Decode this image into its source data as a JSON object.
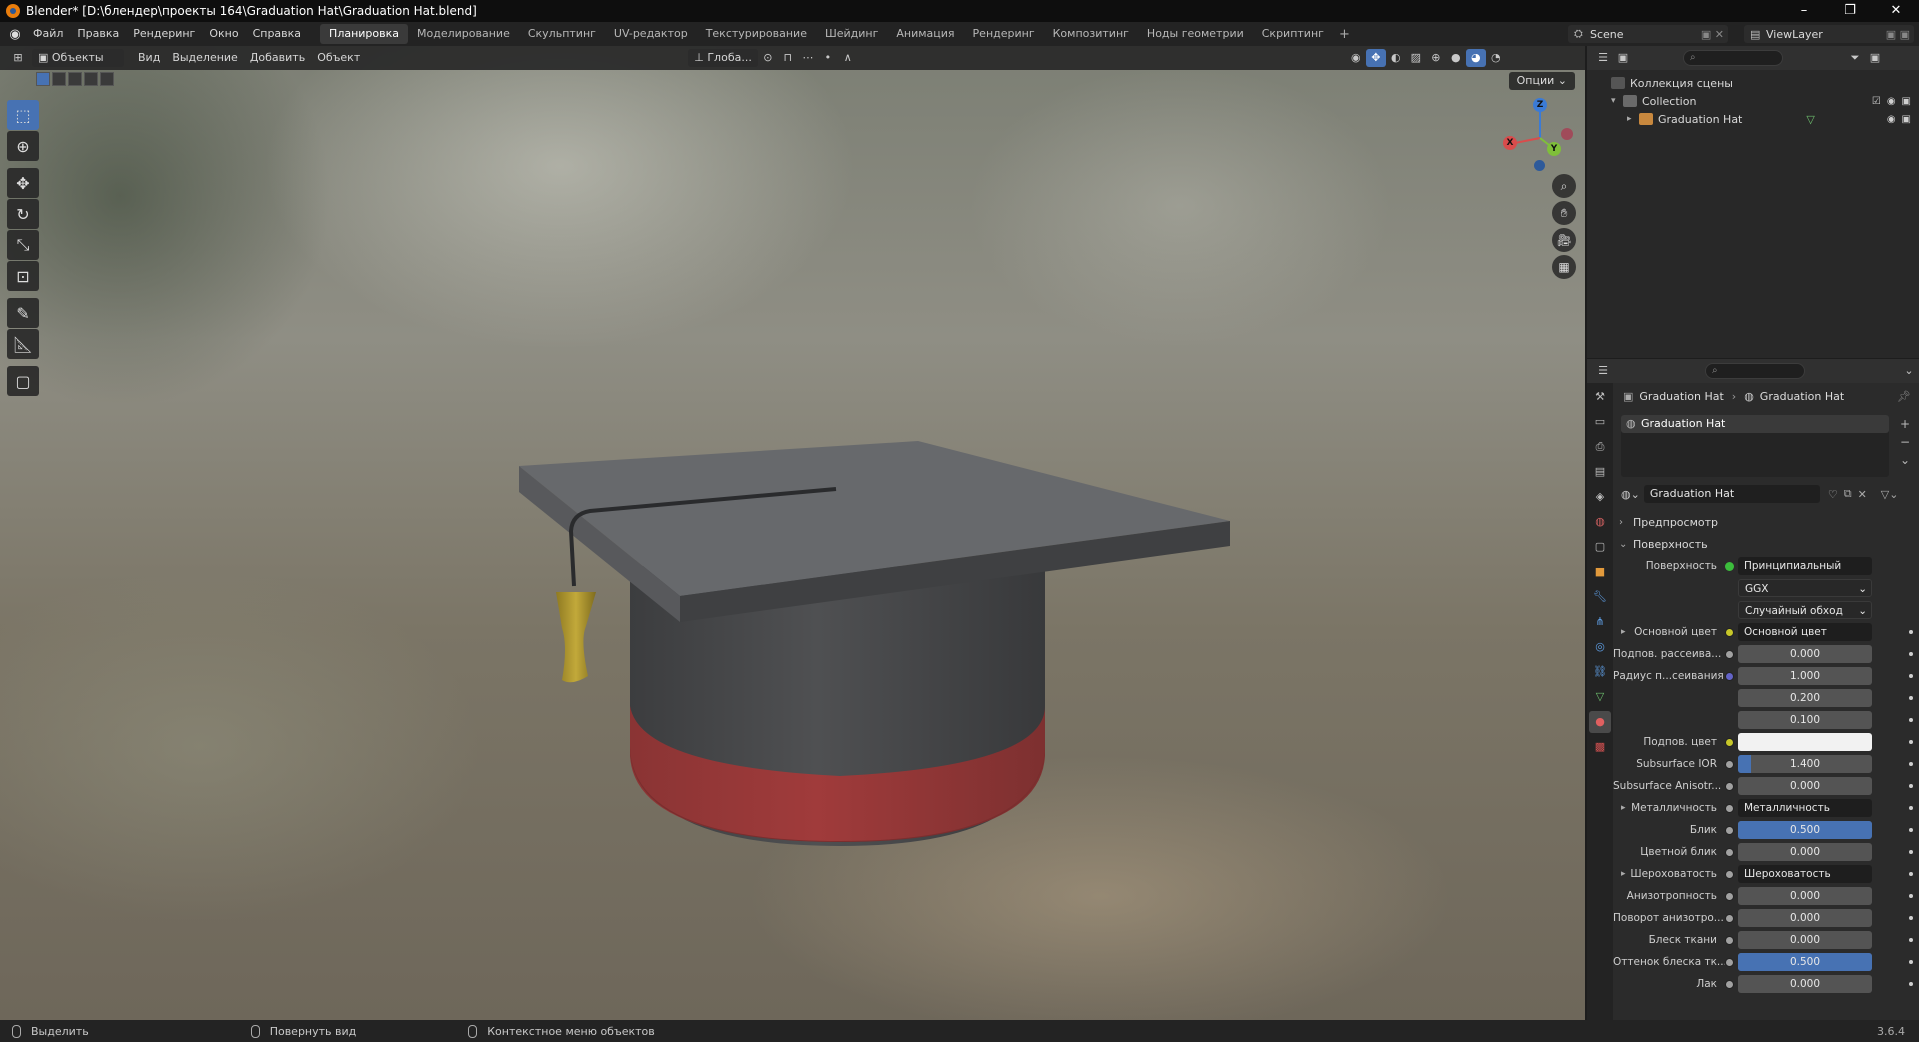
{
  "window": {
    "title": "Blender* [D:\\блендер\\проекты 164\\Graduation Hat\\Graduation Hat.blend]",
    "minimize": "–",
    "maximize": "❐",
    "close": "✕"
  },
  "menubar": {
    "items": [
      "Файл",
      "Правка",
      "Рендеринг",
      "Окно",
      "Справка"
    ],
    "workspaces": [
      "Планировка",
      "Моделирование",
      "Скульптинг",
      "UV-редактор",
      "Текстурирование",
      "Шейдинг",
      "Анимация",
      "Рендеринг",
      "Композитинг",
      "Ноды геометрии",
      "Скриптинг"
    ],
    "active_workspace": "Планировка",
    "add_workspace": "+",
    "scene": "Scene",
    "view_layer": "ViewLayer"
  },
  "viewport": {
    "mode": "Объекты",
    "menus": [
      "Вид",
      "Выделение",
      "Добавить",
      "Объект"
    ],
    "transform_orientation": "Глоба...",
    "options": "Опции",
    "gizmo": {
      "x": "X",
      "y": "Y",
      "z": "Z"
    }
  },
  "outliner": {
    "scene_collection": "Коллекция сцены",
    "collection": "Collection",
    "object": "Graduation Hat"
  },
  "properties": {
    "breadcrumb_object": "Graduation Hat",
    "breadcrumb_material": "Graduation Hat",
    "slot": "Graduation Hat",
    "material_name": "Graduation Hat",
    "sections": {
      "preview": "Предпросмотр",
      "surface": "Поверхность"
    },
    "surface_label": "Поверхность",
    "surface_value": "Принципиальный BSDF",
    "distribution": "GGX",
    "subsurface_method": "Случайный обход",
    "rows": [
      {
        "label": "Основной цвет",
        "value": "Основной цвет",
        "type": "link",
        "dot": "#c7c729",
        "expand": true
      },
      {
        "label": "Подпов. рассеива...",
        "value": "0.000",
        "type": "num",
        "dot": "#a1a1a1"
      },
      {
        "label": "Радиус п...сеивания",
        "value": "1.000",
        "type": "num",
        "dot": "#6363c7"
      },
      {
        "label": "",
        "value": "0.200",
        "type": "num",
        "dot": ""
      },
      {
        "label": "",
        "value": "0.100",
        "type": "num",
        "dot": ""
      },
      {
        "label": "Подпов. цвет",
        "value": "",
        "type": "color",
        "dot": "#c7c729"
      },
      {
        "label": "Subsurface IOR",
        "value": "1.400",
        "type": "num",
        "dot": "#a1a1a1",
        "fill": 0.1
      },
      {
        "label": "Subsurface Anisotr...",
        "value": "0.000",
        "type": "num",
        "dot": "#a1a1a1"
      },
      {
        "label": "Металличность",
        "value": "Металличность",
        "type": "link",
        "dot": "#a1a1a1",
        "expand": true
      },
      {
        "label": "Блик",
        "value": "0.500",
        "type": "num",
        "dot": "#a1a1a1",
        "fill": 1.0
      },
      {
        "label": "Цветной блик",
        "value": "0.000",
        "type": "num",
        "dot": "#a1a1a1"
      },
      {
        "label": "Шероховатость",
        "value": "Шероховатость",
        "type": "link",
        "dot": "#a1a1a1",
        "expand": true
      },
      {
        "label": "Анизотропность",
        "value": "0.000",
        "type": "num",
        "dot": "#a1a1a1"
      },
      {
        "label": "Поворот анизотро...",
        "value": "0.000",
        "type": "num",
        "dot": "#a1a1a1"
      },
      {
        "label": "Блеск ткани",
        "value": "0.000",
        "type": "num",
        "dot": "#a1a1a1"
      },
      {
        "label": "Оттенок блеска тк...",
        "value": "0.500",
        "type": "num",
        "dot": "#a1a1a1",
        "fill": 1.0
      },
      {
        "label": "Лак",
        "value": "0.000",
        "type": "num",
        "dot": "#a1a1a1"
      }
    ]
  },
  "statusbar": {
    "select": "Выделить",
    "rotate": "Повернуть вид",
    "context_menu": "Контекстное меню объектов",
    "version": "3.6.4"
  },
  "colors": {
    "accent": "#4772b3",
    "hat_top": "#646669",
    "hat_body": "#4a4b4d",
    "hat_band": "#9e3a3a",
    "tassel": "#b8a032"
  }
}
